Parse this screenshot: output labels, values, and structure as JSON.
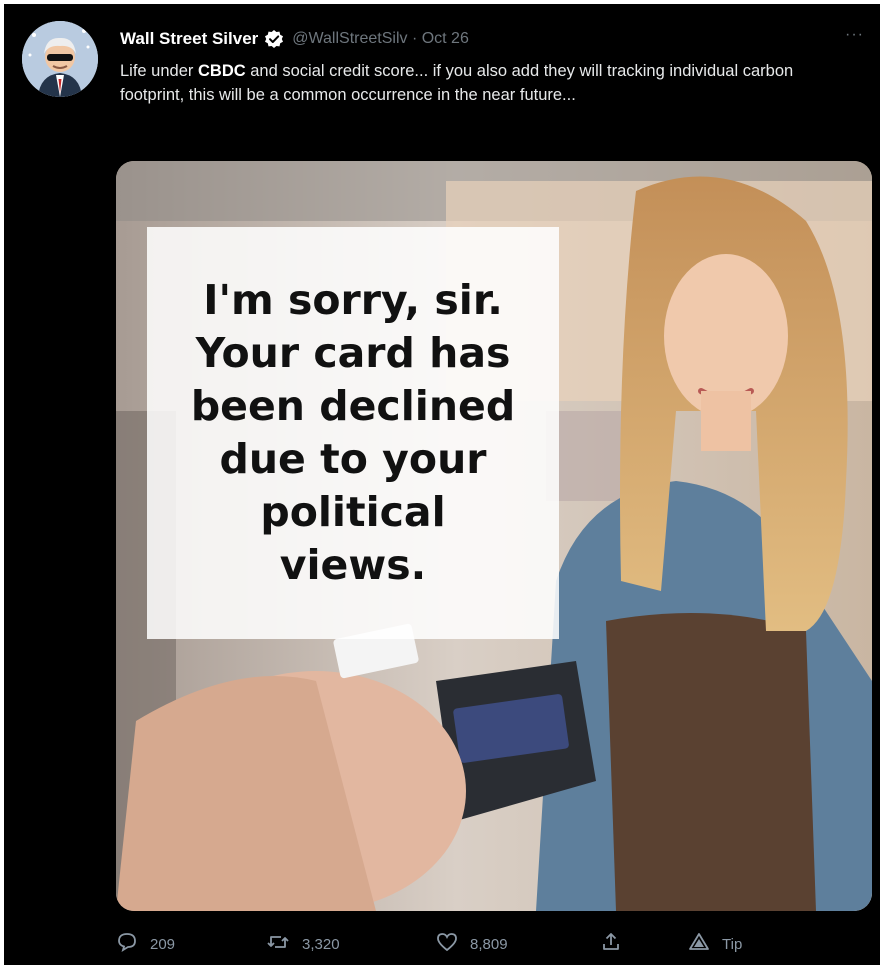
{
  "tweet": {
    "author_name": "Wall Street Silver",
    "handle_date": "@WallStreetSilv · Oct 26",
    "text": {
      "before": "Life under ",
      "bold": "CBDC",
      "after": " and social credit score... if you also add they will tracking individual carbon footprint, this will be a common occurrence in the near future..."
    },
    "more": "···"
  },
  "media": {
    "meme_lines": [
      "I'm sorry, sir.",
      "Your card has",
      "been declined",
      "due to your",
      "political",
      "views."
    ]
  },
  "actions": {
    "replies": "209",
    "retweets": "3,320",
    "likes": "8,809",
    "tip": "Tip"
  },
  "icons": [
    "avatar",
    "verified-badge-icon",
    "more-icon",
    "reply-icon",
    "retweet-icon",
    "like-icon",
    "share-icon",
    "tip-icon"
  ],
  "colors": {
    "background": "#000000",
    "text": "#e7e9ea",
    "muted": "#8b98a5",
    "verified": "#ffffff"
  }
}
